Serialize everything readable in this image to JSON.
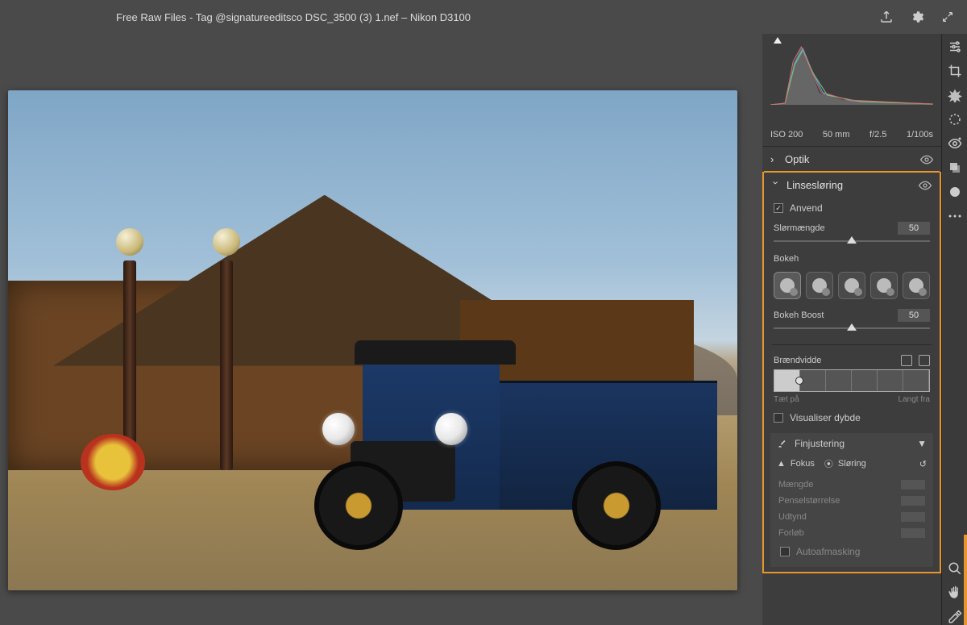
{
  "title": "Free Raw Files - Tag @signatureeditsco DSC_3500 (3) 1.nef  –  Nikon D3100",
  "exif": {
    "iso": "ISO 200",
    "focal": "50 mm",
    "aperture": "f/2.5",
    "shutter": "1/100s"
  },
  "sections": {
    "optics": {
      "label": "Optik"
    },
    "lensblur": {
      "label": "Linsesløring",
      "apply": "Anvend",
      "amount": {
        "label": "Slørmængde",
        "value": "50"
      },
      "bokeh": "Bokeh",
      "boost": {
        "label": "Bokeh Boost",
        "value": "50"
      },
      "focal": {
        "label": "Brændvidde",
        "near": "Tæt på",
        "far": "Langt fra"
      },
      "visualize": "Visualiser dybde"
    },
    "fine": {
      "label": "Finjustering",
      "focus": "Fokus",
      "blur": "Sløring",
      "rows": {
        "amount": "Mængde",
        "brush": "Penselstørrelse",
        "feather": "Udtynd",
        "flow": "Forløb",
        "automask": "Autoafmasking"
      }
    }
  }
}
